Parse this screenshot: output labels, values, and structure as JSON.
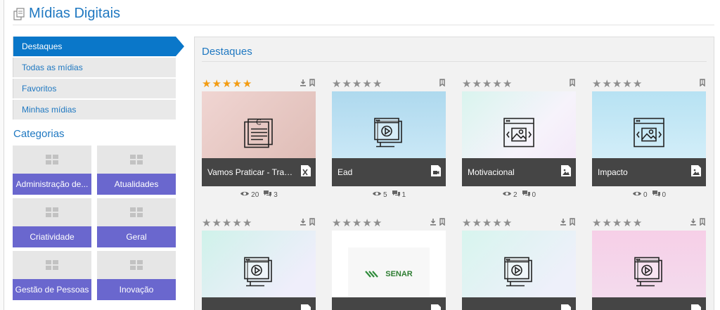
{
  "header": {
    "title": "Mídias Digitais",
    "icon": "documents-icon"
  },
  "sidebar": {
    "nav": [
      {
        "label": "Destaques",
        "active": true
      },
      {
        "label": "Todas as mídias",
        "active": false
      },
      {
        "label": "Favoritos",
        "active": false
      },
      {
        "label": "Minhas mídias",
        "active": false
      }
    ],
    "categories_title": "Categorias",
    "categories": [
      {
        "label": "Administração de..."
      },
      {
        "label": "Atualidades"
      },
      {
        "label": "Criatividade"
      },
      {
        "label": "Geral"
      },
      {
        "label": "Gestão de Pessoas"
      },
      {
        "label": "Inovação"
      }
    ]
  },
  "main": {
    "title": "Destaques",
    "cards": [
      {
        "title": "Vamos Praticar - Trabal...",
        "rating": 5,
        "views": "20",
        "comments": "3",
        "thumb": "document-list",
        "bg": "pink",
        "file_icon": "excel-file-icon",
        "download": true,
        "bookmark": true
      },
      {
        "title": "Ead",
        "rating": 0,
        "views": "5",
        "comments": "1",
        "thumb": "video-player",
        "bg": "blue",
        "file_icon": "video-file-icon",
        "download": false,
        "bookmark": true
      },
      {
        "title": "Motivacional",
        "rating": 0,
        "views": "2",
        "comments": "0",
        "thumb": "image-gallery",
        "bg": "mint",
        "file_icon": "image-file-icon",
        "download": false,
        "bookmark": true
      },
      {
        "title": "Impacto",
        "rating": 0,
        "views": "0",
        "comments": "0",
        "thumb": "image-gallery",
        "bg": "blue2",
        "file_icon": "image-file-icon",
        "download": false,
        "bookmark": true
      },
      {
        "title": "",
        "rating": 0,
        "thumb": "video-player",
        "bg": "mint2",
        "file_icon": "video-file-icon",
        "download": true,
        "bookmark": true
      },
      {
        "title": "",
        "rating": 0,
        "thumb": "senar-logo",
        "logo_text": "SENAR",
        "bg": "white",
        "file_icon": "video-file-icon",
        "download": true,
        "bookmark": true
      },
      {
        "title": "",
        "rating": 0,
        "thumb": "video-player",
        "bg": "mint3",
        "file_icon": "video-file-icon",
        "download": true,
        "bookmark": true
      },
      {
        "title": "",
        "rating": 0,
        "thumb": "video-player",
        "bg": "pink2",
        "file_icon": "video-file-icon",
        "download": true,
        "bookmark": true
      }
    ]
  }
}
